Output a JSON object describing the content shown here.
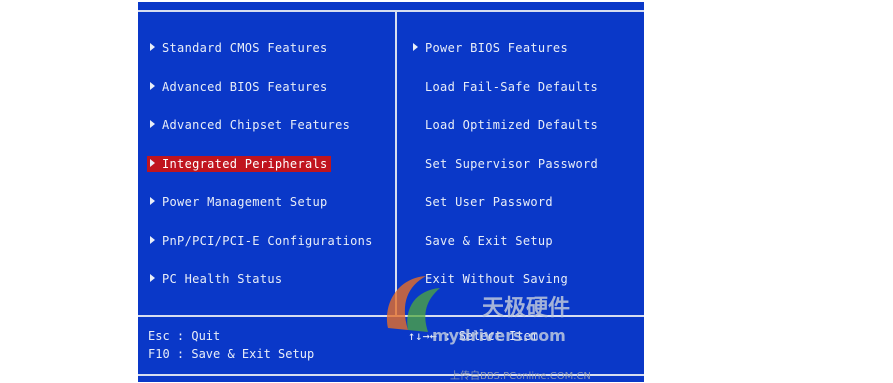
{
  "left_menu": [
    {
      "label": "Standard CMOS Features",
      "arrow": true,
      "selected": false
    },
    {
      "label": "Advanced BIOS Features",
      "arrow": true,
      "selected": false
    },
    {
      "label": "Advanced Chipset Features",
      "arrow": true,
      "selected": false
    },
    {
      "label": "Integrated Peripherals",
      "arrow": true,
      "selected": true
    },
    {
      "label": "Power Management Setup",
      "arrow": true,
      "selected": false
    },
    {
      "label": "PnP/PCI/PCI-E Configurations",
      "arrow": true,
      "selected": false
    },
    {
      "label": "PC Health Status",
      "arrow": true,
      "selected": false
    }
  ],
  "right_menu": [
    {
      "label": "Power BIOS Features",
      "arrow": true
    },
    {
      "label": "Load Fail-Safe Defaults",
      "arrow": false
    },
    {
      "label": "Load Optimized Defaults",
      "arrow": false
    },
    {
      "label": "Set Supervisor Password",
      "arrow": false
    },
    {
      "label": "Set User Password",
      "arrow": false
    },
    {
      "label": "Save & Exit Setup",
      "arrow": false
    },
    {
      "label": "Exit Without Saving",
      "arrow": false
    }
  ],
  "help": {
    "line1": "Esc : Quit",
    "line2": "F10 : Save & Exit Setup",
    "line3": "↑↓→← : Select Item"
  },
  "watermark": {
    "brand": "天极硬件",
    "url": "mydrivers.com",
    "footer": "上传自BBS.PConline.COM.CN"
  },
  "colors": {
    "background": "#0a38c8",
    "highlight": "#c0141e",
    "text": "#e9eef8"
  }
}
